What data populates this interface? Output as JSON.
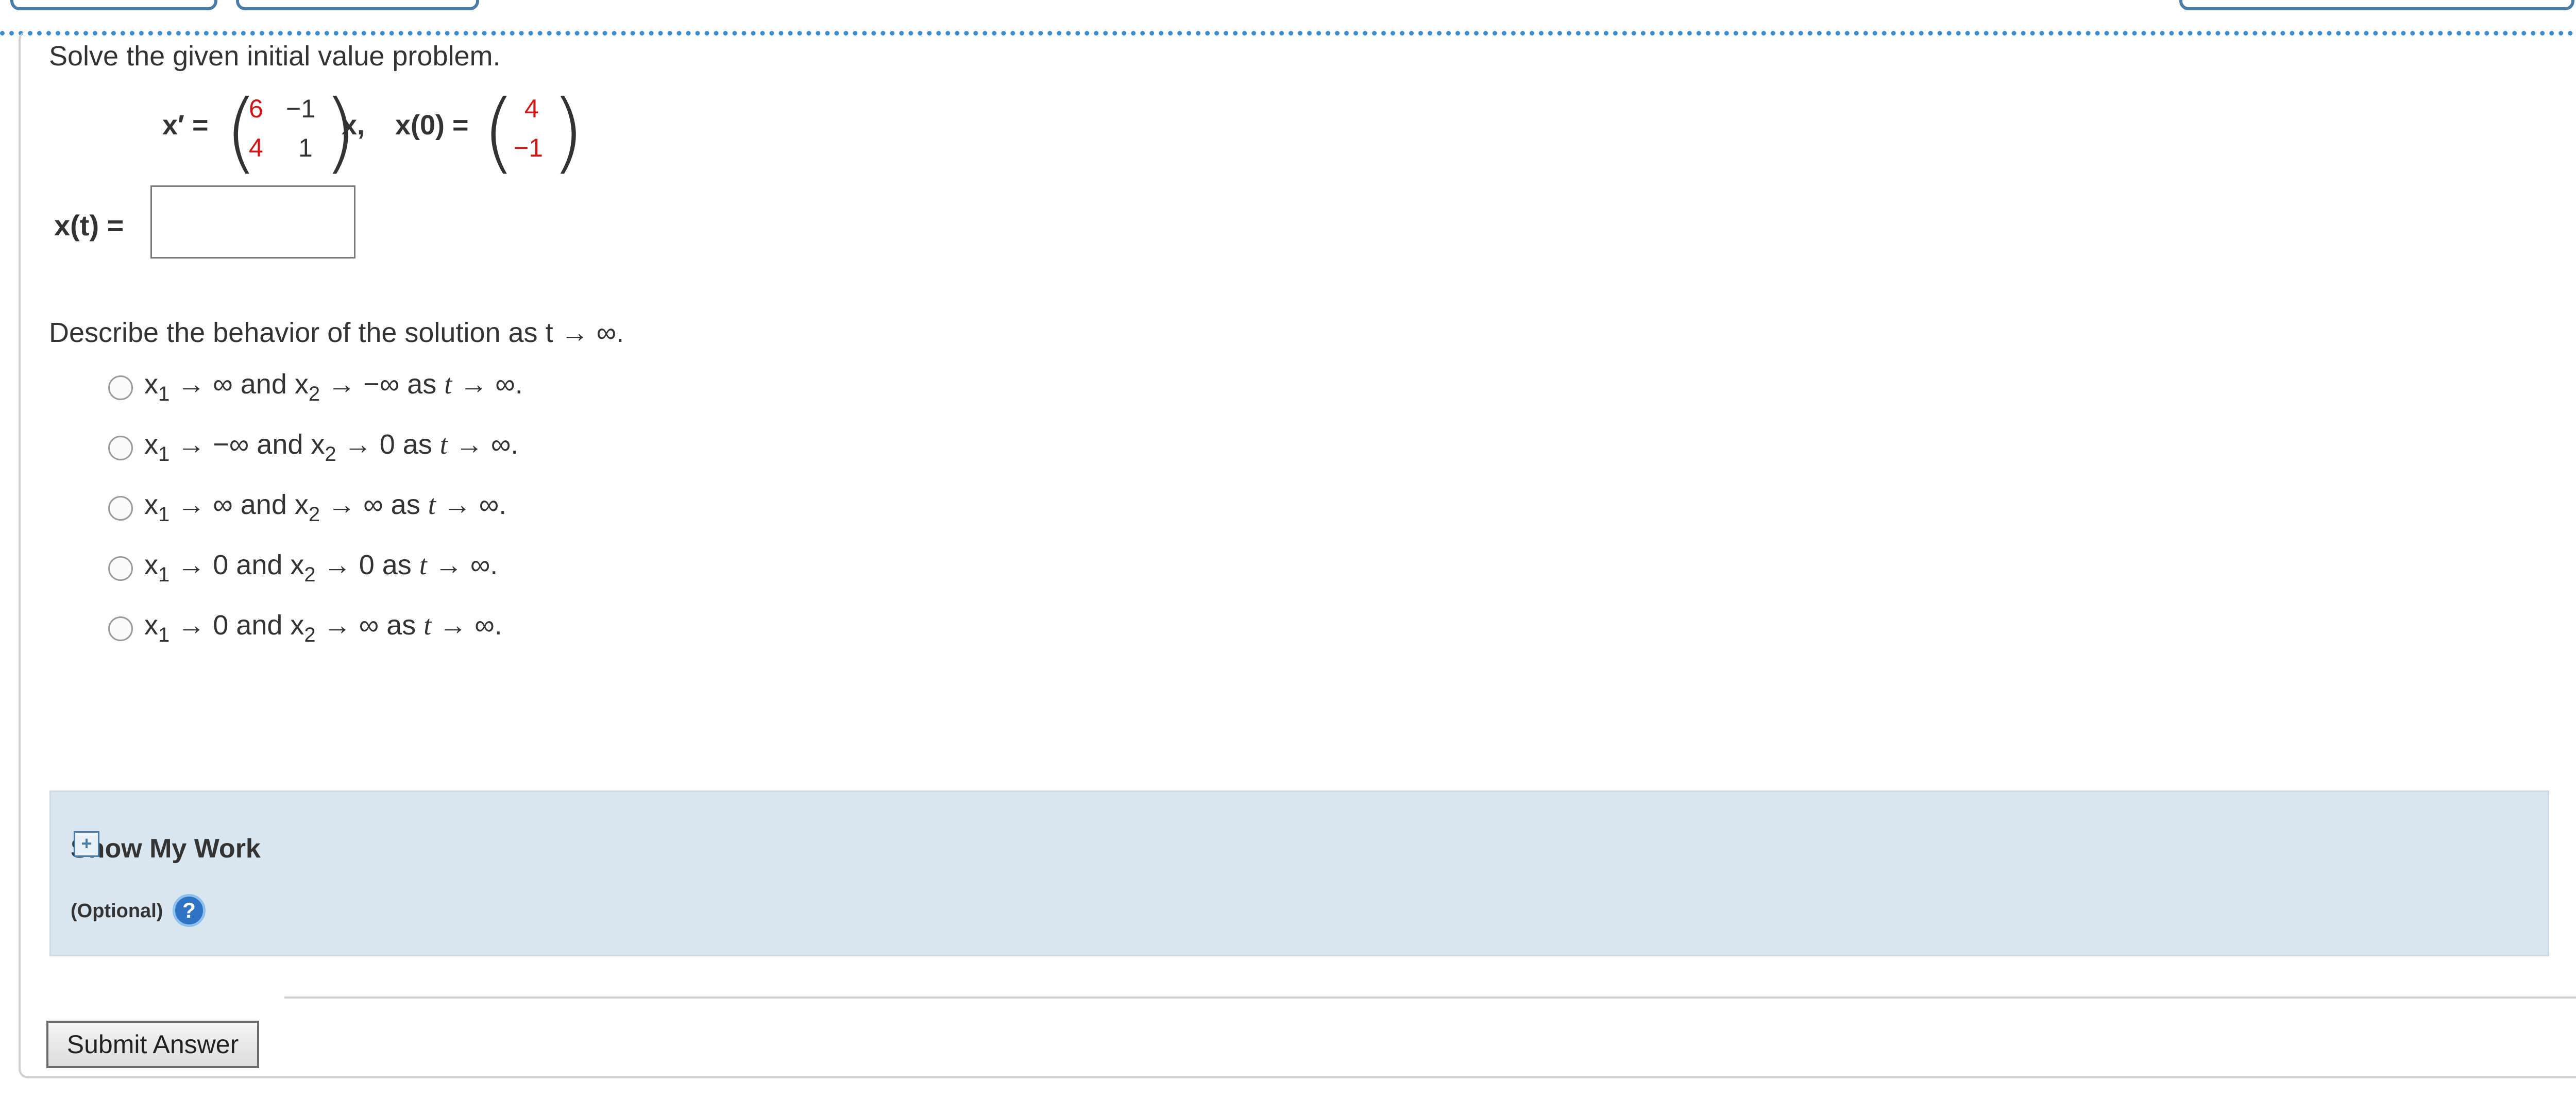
{
  "problem": {
    "prompt": "Solve the given initial value problem.",
    "equation": {
      "lhs": "x′ =",
      "matrix": [
        "6",
        "−1",
        "4",
        "1"
      ],
      "rhs_var": "x,",
      "init_label": "x(0) =",
      "init_vector": [
        "4",
        "−1"
      ]
    },
    "answer_label": "x(t) =",
    "answer_value": ""
  },
  "behavior": {
    "question": "Describe the behavior of the solution as  t → ∞.",
    "options": [
      {
        "x1": "x",
        "x1_sub": "1",
        "x1_limit": "→ ∞ and",
        "x2": "x",
        "x2_sub": "2",
        "x2_limit": "→ −∞ as",
        "t": "t",
        "tail": "→ ∞."
      },
      {
        "x1": "x",
        "x1_sub": "1",
        "x1_limit": "→ −∞ and",
        "x2": "x",
        "x2_sub": "2",
        "x2_limit": "→ 0 as",
        "t": "t",
        "tail": "→ ∞."
      },
      {
        "x1": "x",
        "x1_sub": "1",
        "x1_limit": "→ ∞ and",
        "x2": "x",
        "x2_sub": "2",
        "x2_limit": "→ ∞ as",
        "t": "t",
        "tail": "→ ∞."
      },
      {
        "x1": "x",
        "x1_sub": "1",
        "x1_limit": "→ 0 and",
        "x2": "x",
        "x2_sub": "2",
        "x2_limit": "→ 0 as",
        "t": "t",
        "tail": "→ ∞."
      },
      {
        "x1": "x",
        "x1_sub": "1",
        "x1_limit": "→ 0 and",
        "x2": "x",
        "x2_sub": "2",
        "x2_limit": "→ ∞ as",
        "t": "t",
        "tail": "→ ∞."
      }
    ]
  },
  "work": {
    "title": "Show My Work",
    "plus": "+",
    "optional": "(Optional)",
    "help": "?"
  },
  "submit_label": "Submit Answer",
  "colors": {
    "accent": "#3a8ecf",
    "highlight": "#d21414",
    "panel": "#d9e5ef"
  }
}
